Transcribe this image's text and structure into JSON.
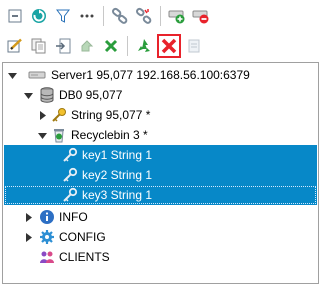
{
  "toolbar1": {
    "buttons": [
      "collapse-icon",
      "refresh-icon",
      "filter-icon",
      "more-icon",
      "link-icon",
      "unlink-icon",
      "add-connection-icon",
      "remove-connection-icon"
    ]
  },
  "toolbar2": {
    "buttons": [
      "edit-icon",
      "copy-icon",
      "import-icon",
      "move-icon",
      "close-x-icon",
      "recycle-icon",
      "delete-icon",
      "clear-icon"
    ]
  },
  "tree": {
    "server": {
      "label": "Server1 95,077 192.168.56.100:6379"
    },
    "db": {
      "label": "DB0 95,077"
    },
    "string_group": {
      "label": "String 95,077 *"
    },
    "recyclebin": {
      "label": "Recyclebin 3 *"
    },
    "keys": [
      {
        "label": "key1 String 1"
      },
      {
        "label": "key2 String 1"
      },
      {
        "label": "key3 String 1"
      }
    ],
    "info": {
      "label": "INFO"
    },
    "config": {
      "label": "CONFIG"
    },
    "clients": {
      "label": "CLIENTS"
    }
  },
  "colors": {
    "selection": "#0788c8",
    "accent_red": "#e8222b",
    "accent_green": "#2a9d3c"
  }
}
